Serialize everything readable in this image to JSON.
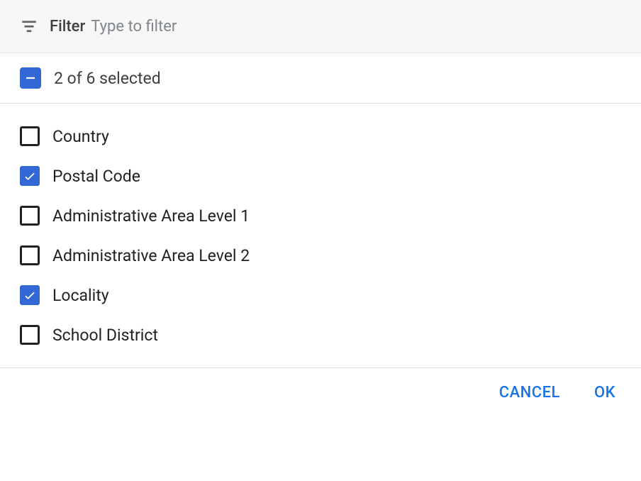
{
  "filter": {
    "label": "Filter",
    "placeholder": "Type to filter"
  },
  "summary": {
    "text": "2 of 6 selected"
  },
  "options": [
    {
      "label": "Country",
      "checked": false
    },
    {
      "label": "Postal Code",
      "checked": true
    },
    {
      "label": "Administrative Area Level 1",
      "checked": false
    },
    {
      "label": "Administrative Area Level 2",
      "checked": false
    },
    {
      "label": "Locality",
      "checked": true
    },
    {
      "label": "School District",
      "checked": false
    }
  ],
  "actions": {
    "cancel": "CANCEL",
    "ok": "OK"
  }
}
